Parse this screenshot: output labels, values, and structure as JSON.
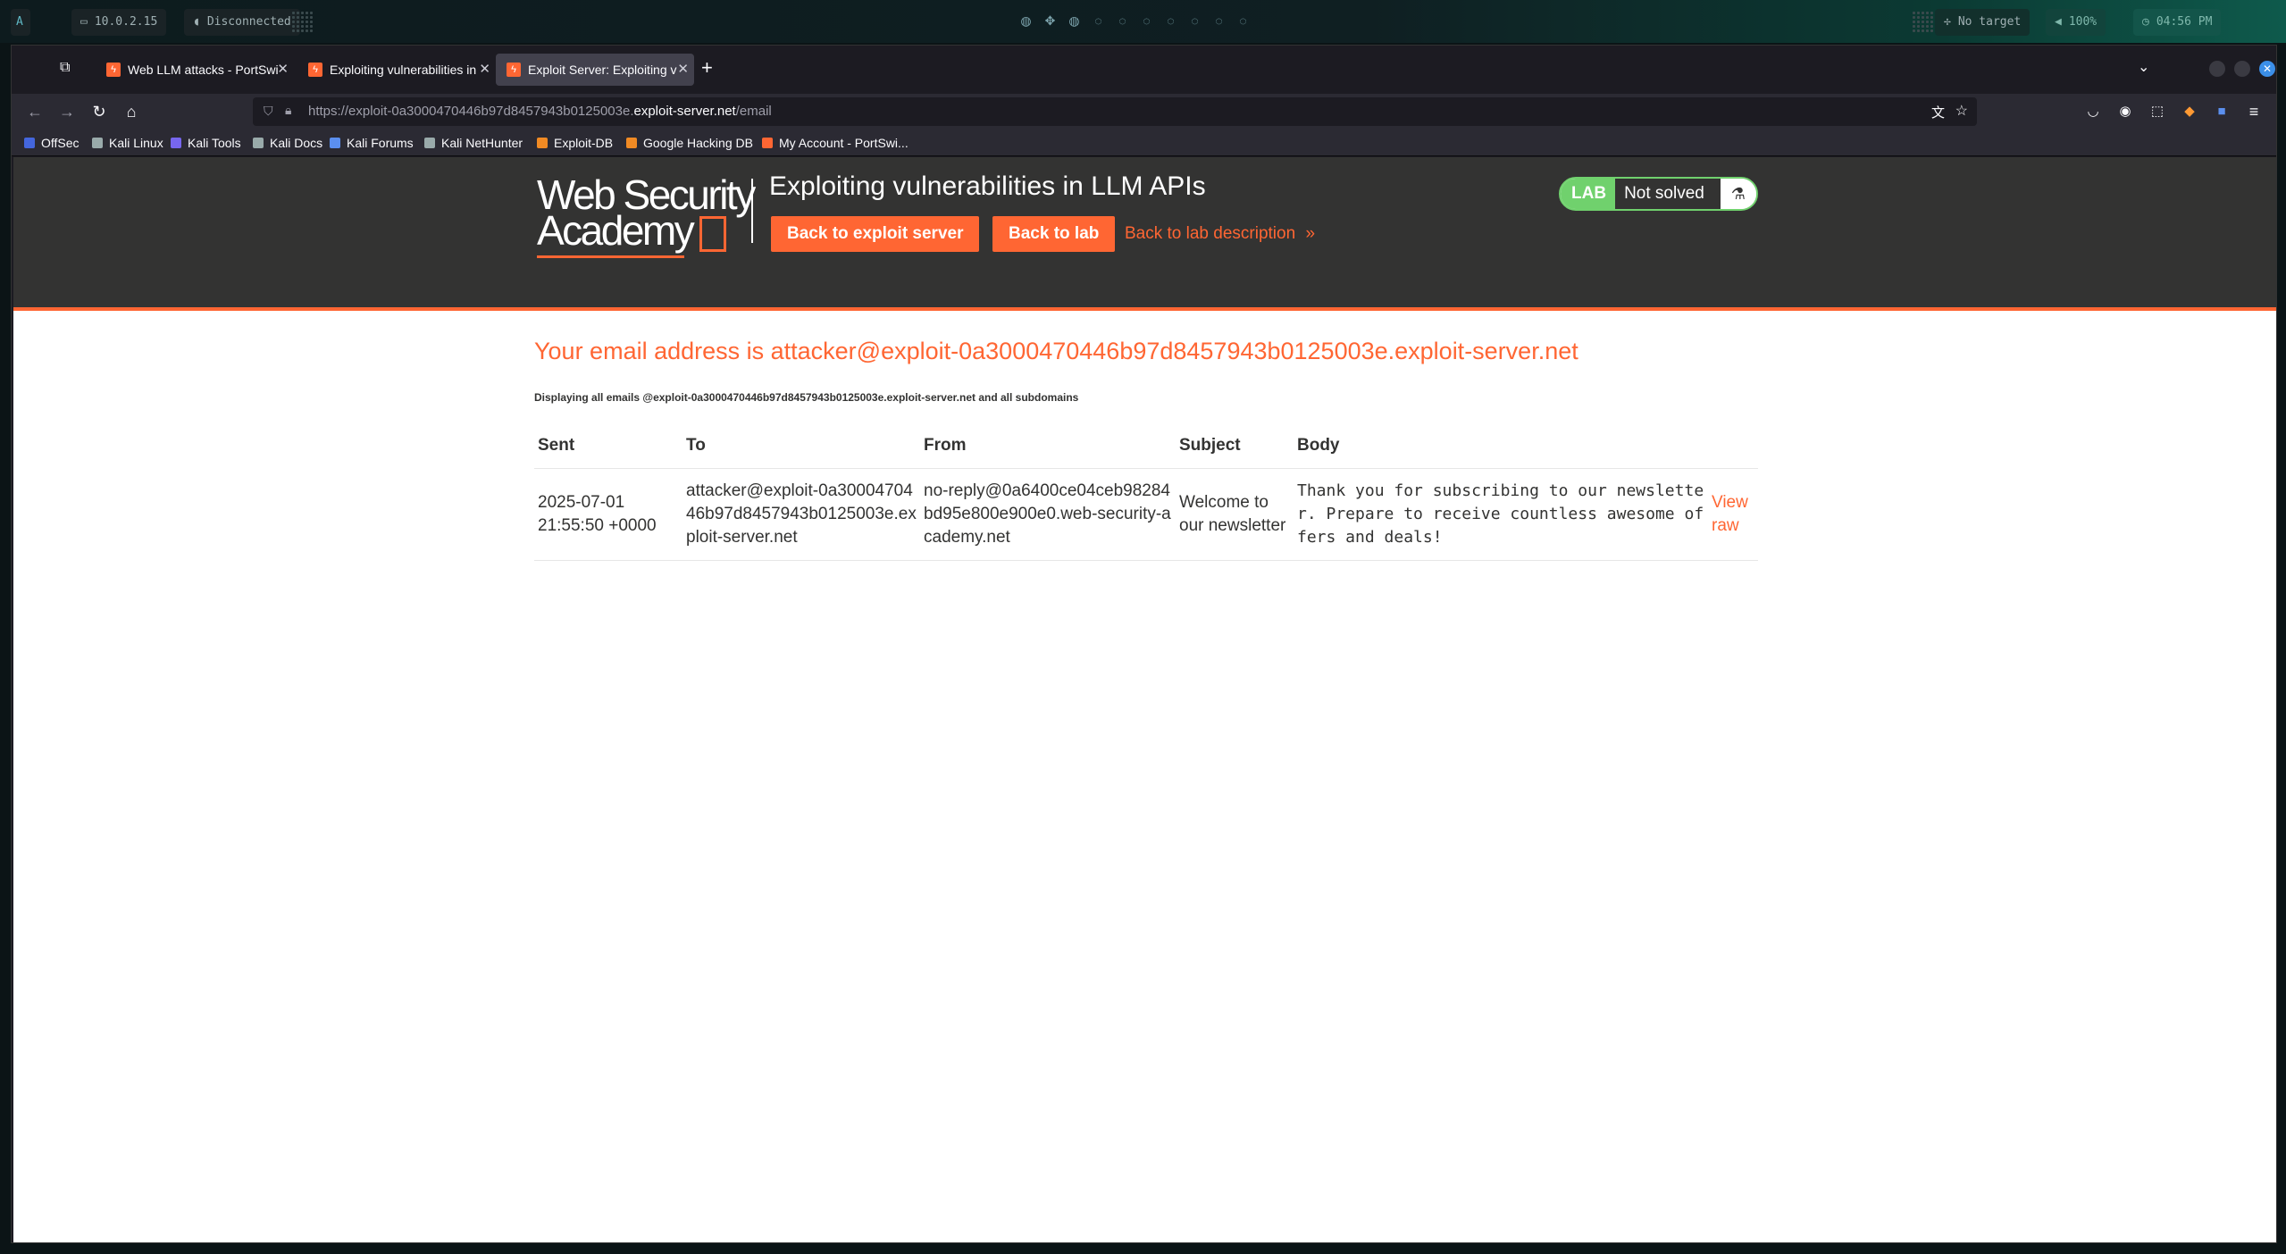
{
  "desktop": {
    "ip": "10.0.2.15",
    "vpn_status": "Disconnected",
    "target": "No target",
    "volume": "100%",
    "clock": "04:56 PM"
  },
  "browser": {
    "tabs": [
      {
        "label": "Web LLM attacks - PortSwi",
        "active": false
      },
      {
        "label": "Exploiting vulnerabilities in",
        "active": false
      },
      {
        "label": "Exploit Server: Exploiting v",
        "active": true
      }
    ],
    "url_prefix": "https://exploit-0a3000470446b97d8457943b0125003e.",
    "url_domain": "exploit-server.net",
    "url_path": "/email",
    "bookmarks": [
      "OffSec",
      "Kali Linux",
      "Kali Tools",
      "Kali Docs",
      "Kali Forums",
      "Kali NetHunter",
      "Exploit-DB",
      "Google Hacking DB",
      "My Account - PortSwi..."
    ]
  },
  "header": {
    "logo_line1": "Web Security",
    "logo_line2": "Academy",
    "lab_title": "Exploiting vulnerabilities in LLM APIs",
    "btn_exploit_server": "Back to exploit server",
    "btn_lab": "Back to lab",
    "link_description": "Back to lab description",
    "badge_label": "LAB",
    "badge_status": "Not solved"
  },
  "main": {
    "heading": "Your email address is attacker@exploit-0a3000470446b97d8457943b0125003e.exploit-server.net",
    "subheading": "Displaying all emails @exploit-0a3000470446b97d8457943b0125003e.exploit-server.net and all subdomains",
    "columns": [
      "Sent",
      "To",
      "From",
      "Subject",
      "Body"
    ],
    "rows": [
      {
        "sent_date": "2025-07-01",
        "sent_time": "21:55:50 +0000",
        "to": "attacker@exploit-0a3000470446b97d8457943b0125003e.exploit-server.net",
        "from": "no-reply@0a6400ce04ceb98284bd95e800e900e0.web-security-academy.net",
        "subject": "Welcome to our newsletter",
        "body": "Thank you for subscribing to our newsletter. Prepare to receive countless awesome offers and deals!",
        "action": "View raw"
      }
    ]
  },
  "colors": {
    "accent": "#ff6633",
    "header_bg": "#333332",
    "lab_green": "#70d16d"
  }
}
